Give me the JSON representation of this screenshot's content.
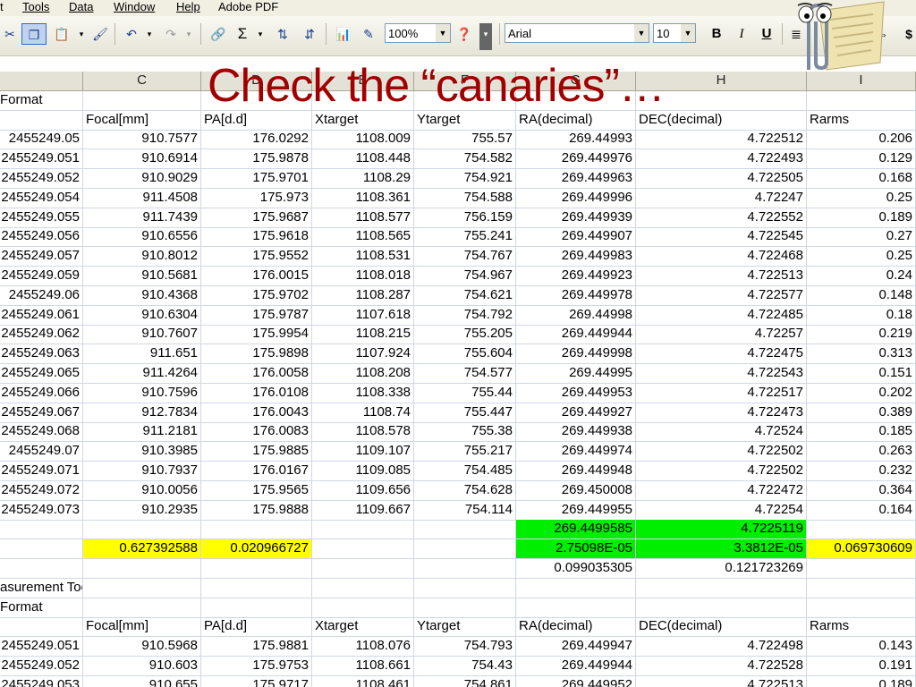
{
  "menu": {
    "items": [
      "t",
      "Tools",
      "Data",
      "Window",
      "Help",
      "Adobe PDF"
    ]
  },
  "toolbar": {
    "zoom": "100%",
    "font_name": "Arial",
    "font_size": "10",
    "sum_label": "Σ",
    "bold_label": "B",
    "italic_label": "I",
    "underline_label": "U"
  },
  "title": "Check the “canaries”…",
  "columns": {
    "letters": [
      "C",
      "D",
      "E",
      "F",
      "G",
      "H",
      "I"
    ]
  },
  "sheet": {
    "section1_label": "Format",
    "headers": [
      "Focal[mm]",
      "PA[d.d]",
      "Xtarget",
      "Ytarget",
      "RA(decimal)",
      "DEC(decimal)",
      "Rarms"
    ],
    "rows": [
      [
        "2455249.05",
        "910.7577",
        "176.0292",
        "1108.009",
        "755.57",
        "269.44993",
        "4.722512",
        "0.206"
      ],
      [
        "2455249.051",
        "910.6914",
        "175.9878",
        "1108.448",
        "754.582",
        "269.449976",
        "4.722493",
        "0.129"
      ],
      [
        "2455249.052",
        "910.9029",
        "175.9701",
        "1108.29",
        "754.921",
        "269.449963",
        "4.722505",
        "0.168"
      ],
      [
        "2455249.054",
        "911.4508",
        "175.973",
        "1108.361",
        "754.588",
        "269.449996",
        "4.72247",
        "0.25"
      ],
      [
        "2455249.055",
        "911.7439",
        "175.9687",
        "1108.577",
        "756.159",
        "269.449939",
        "4.722552",
        "0.189"
      ],
      [
        "2455249.056",
        "910.6556",
        "175.9618",
        "1108.565",
        "755.241",
        "269.449907",
        "4.722545",
        "0.27"
      ],
      [
        "2455249.057",
        "910.8012",
        "175.9552",
        "1108.531",
        "754.767",
        "269.449983",
        "4.722468",
        "0.25"
      ],
      [
        "2455249.059",
        "910.5681",
        "176.0015",
        "1108.018",
        "754.967",
        "269.449923",
        "4.722513",
        "0.24"
      ],
      [
        "2455249.06",
        "910.4368",
        "175.9702",
        "1108.287",
        "754.621",
        "269.449978",
        "4.722577",
        "0.148"
      ],
      [
        "2455249.061",
        "910.6304",
        "175.9787",
        "1107.618",
        "754.792",
        "269.44998",
        "4.722485",
        "0.18"
      ],
      [
        "2455249.062",
        "910.7607",
        "175.9954",
        "1108.215",
        "755.205",
        "269.449944",
        "4.72257",
        "0.219"
      ],
      [
        "2455249.063",
        "911.651",
        "175.9898",
        "1107.924",
        "755.604",
        "269.449998",
        "4.722475",
        "0.313"
      ],
      [
        "2455249.065",
        "911.4264",
        "176.0058",
        "1108.208",
        "754.577",
        "269.44995",
        "4.722543",
        "0.151"
      ],
      [
        "2455249.066",
        "910.7596",
        "176.0108",
        "1108.338",
        "755.44",
        "269.449953",
        "4.722517",
        "0.202"
      ],
      [
        "2455249.067",
        "912.7834",
        "176.0043",
        "1108.74",
        "755.447",
        "269.449927",
        "4.722473",
        "0.389"
      ],
      [
        "2455249.068",
        "911.2181",
        "176.0083",
        "1108.578",
        "755.38",
        "269.449938",
        "4.72524",
        "0.185"
      ],
      [
        "2455249.07",
        "910.3985",
        "175.9885",
        "1109.107",
        "755.217",
        "269.449974",
        "4.722502",
        "0.263"
      ],
      [
        "2455249.071",
        "910.7937",
        "176.0167",
        "1109.085",
        "754.485",
        "269.449948",
        "4.722502",
        "0.232"
      ],
      [
        "2455249.072",
        "910.0056",
        "175.9565",
        "1109.656",
        "754.628",
        "269.450008",
        "4.722472",
        "0.364"
      ],
      [
        "2455249.073",
        "910.2935",
        "175.9888",
        "1109.667",
        "754.114",
        "269.449955",
        "4.72254",
        "0.164"
      ]
    ],
    "stats": {
      "mean_ra": "269.4499585",
      "mean_dec": "4.7225119",
      "focal_sd": "0.627392588",
      "pa_sd": "0.020966727",
      "ra_sd": "2.75098E-05",
      "dec_sd": "3.3812E-05",
      "rarms_sd": "0.069730609",
      "ra_x": "0.099035305",
      "dec_x": "0.121723269"
    },
    "section2_label_a": "asurement Tool",
    "section2_label_b": "Format",
    "headers2": [
      "Focal[mm]",
      "PA[d.d]",
      "Xtarget",
      "Ytarget",
      "RA(decimal)",
      "DEC(decimal)",
      "Rarms"
    ],
    "rows2": [
      [
        "2455249.051",
        "910.5968",
        "175.9881",
        "1108.076",
        "754.793",
        "269.449947",
        "4.722498",
        "0.143"
      ],
      [
        "2455249.052",
        "910.603",
        "175.9753",
        "1108.661",
        "754.43",
        "269.449944",
        "4.722528",
        "0.191"
      ],
      [
        "2455249.053",
        "910.655",
        "175.9717",
        "1108.461",
        "754.861",
        "269.449952",
        "4.722513",
        "0.189"
      ]
    ]
  }
}
